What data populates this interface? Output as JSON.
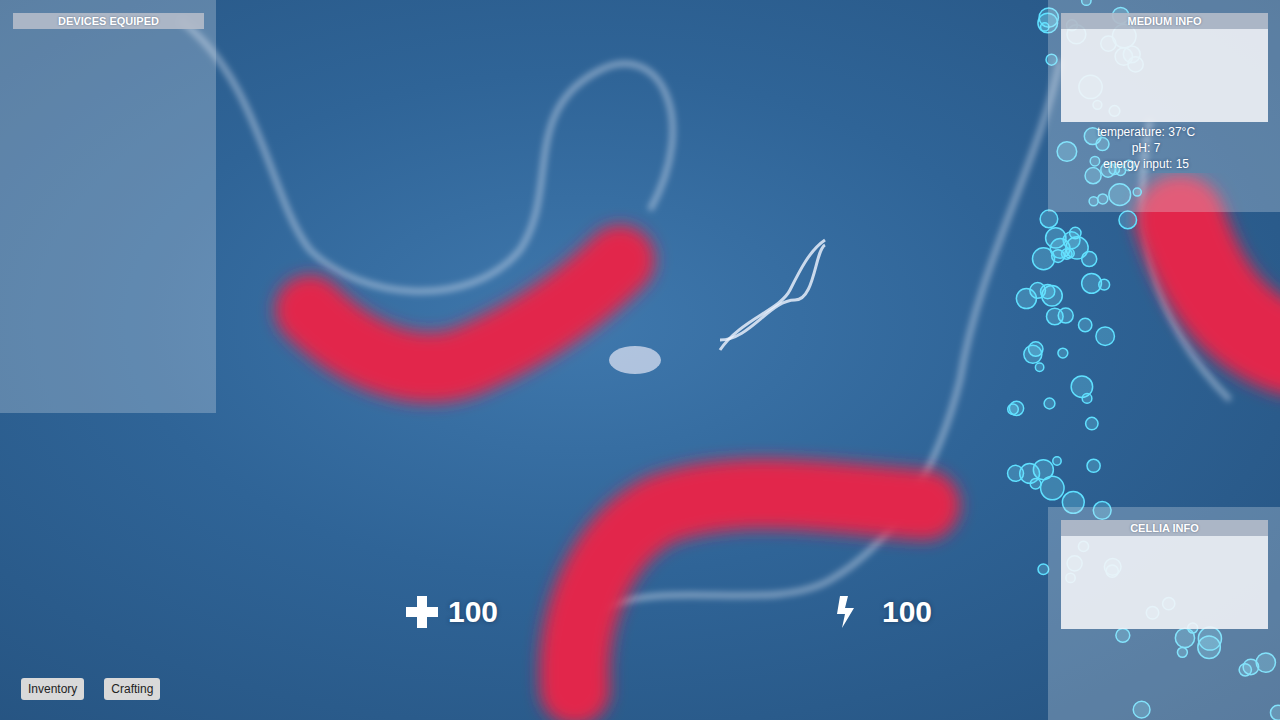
{
  "panels": {
    "devices": {
      "title": "DEVICES EQUIPED"
    },
    "medium": {
      "title": "MEDIUM INFO",
      "lines": [
        "temperature: 37°C",
        "pH: 7",
        "energy input: 15"
      ]
    },
    "cellia": {
      "title": "CELLIA INFO"
    }
  },
  "stats": [
    {
      "kind": "health",
      "value": "100"
    },
    {
      "kind": "energy",
      "value": "100"
    }
  ],
  "buttons": [
    "Inventory",
    "Crafting"
  ]
}
